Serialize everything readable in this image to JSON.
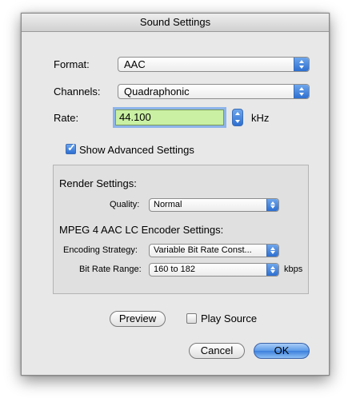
{
  "window": {
    "title": "Sound Settings"
  },
  "format": {
    "label": "Format:",
    "value": "AAC"
  },
  "channels": {
    "label": "Channels:",
    "value": "Quadraphonic"
  },
  "rate": {
    "label": "Rate:",
    "value": "44.100",
    "unit": "kHz"
  },
  "show_advanced": {
    "label": "Show Advanced Settings",
    "checked": true
  },
  "render_settings": {
    "heading": "Render Settings:",
    "quality_label": "Quality:",
    "quality_value": "Normal"
  },
  "encoder_settings": {
    "heading": "MPEG 4 AAC LC Encoder Settings:",
    "strategy_label": "Encoding Strategy:",
    "strategy_value": "Variable Bit Rate Const...",
    "bitrate_label": "Bit Rate Range:",
    "bitrate_value": "160 to 182",
    "bitrate_unit": "kbps"
  },
  "preview_button": "Preview",
  "play_source": {
    "label": "Play Source",
    "checked": false
  },
  "cancel_button": "Cancel",
  "ok_button": "OK",
  "colors": {
    "accent_blue": "#3b7fdd",
    "field_highlight": "#c9f0a3",
    "focus_ring": "#8cb4ea"
  },
  "icons": {
    "popup_arrows": "updown-arrows-icon",
    "stepper": "stepper-icon",
    "checkmark": "checkmark-icon"
  }
}
